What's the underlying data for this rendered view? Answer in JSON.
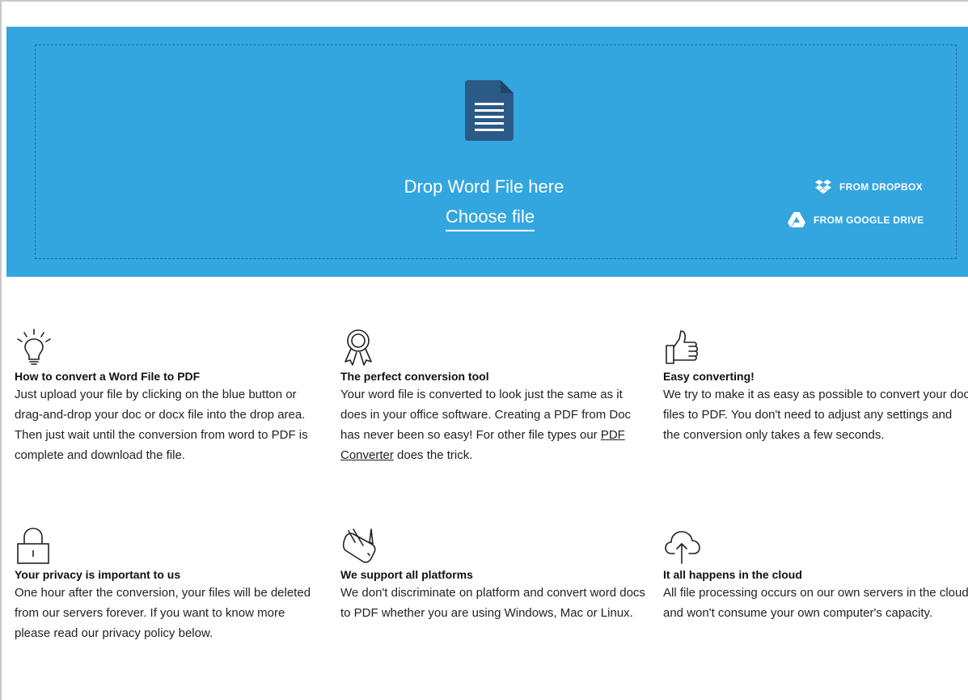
{
  "dropzone": {
    "drop_text": "Drop Word File here",
    "choose_file": "Choose file",
    "dropbox_label": "FROM DROPBOX",
    "gdrive_label": "FROM GOOGLE DRIVE",
    "background_color": "#33a6e0",
    "doc_icon": "word-document-icon"
  },
  "features": [
    {
      "icon": "lightbulb-icon",
      "title": "How to convert a Word File to PDF",
      "text": "Just upload your file by clicking on the blue button or drag-and-drop your doc or docx file into the drop area. Then just wait until the conversion from word to PDF is complete and download the file."
    },
    {
      "icon": "award-ribbon-icon",
      "title": "The perfect conversion tool",
      "text_before_link": "Your word file is converted to look just the same as it does in your office software. Creating a PDF from Doc has never been so easy! For other file types our ",
      "link": "PDF Converter",
      "text_after_link": " does the trick."
    },
    {
      "icon": "thumbs-up-icon",
      "title": "Easy converting!",
      "text": "We try to make it as easy as possible to convert your doc files to PDF. You don't need to adjust any settings and the conversion only takes a few seconds."
    },
    {
      "icon": "padlock-icon",
      "title": "Your privacy is important to us",
      "text": "One hour after the conversion, your files will be deleted from our servers forever. If you want to know more please read our privacy policy below."
    },
    {
      "icon": "swiss-army-knife-icon",
      "title": "We support all platforms",
      "text": "We don't discriminate on platform and convert word docs to PDF whether you are using Windows, Mac or Linux."
    },
    {
      "icon": "cloud-upload-icon",
      "title": "It all happens in the cloud",
      "text": "All file processing occurs on our own servers in the cloud and won't consume your own computer's capacity."
    }
  ]
}
